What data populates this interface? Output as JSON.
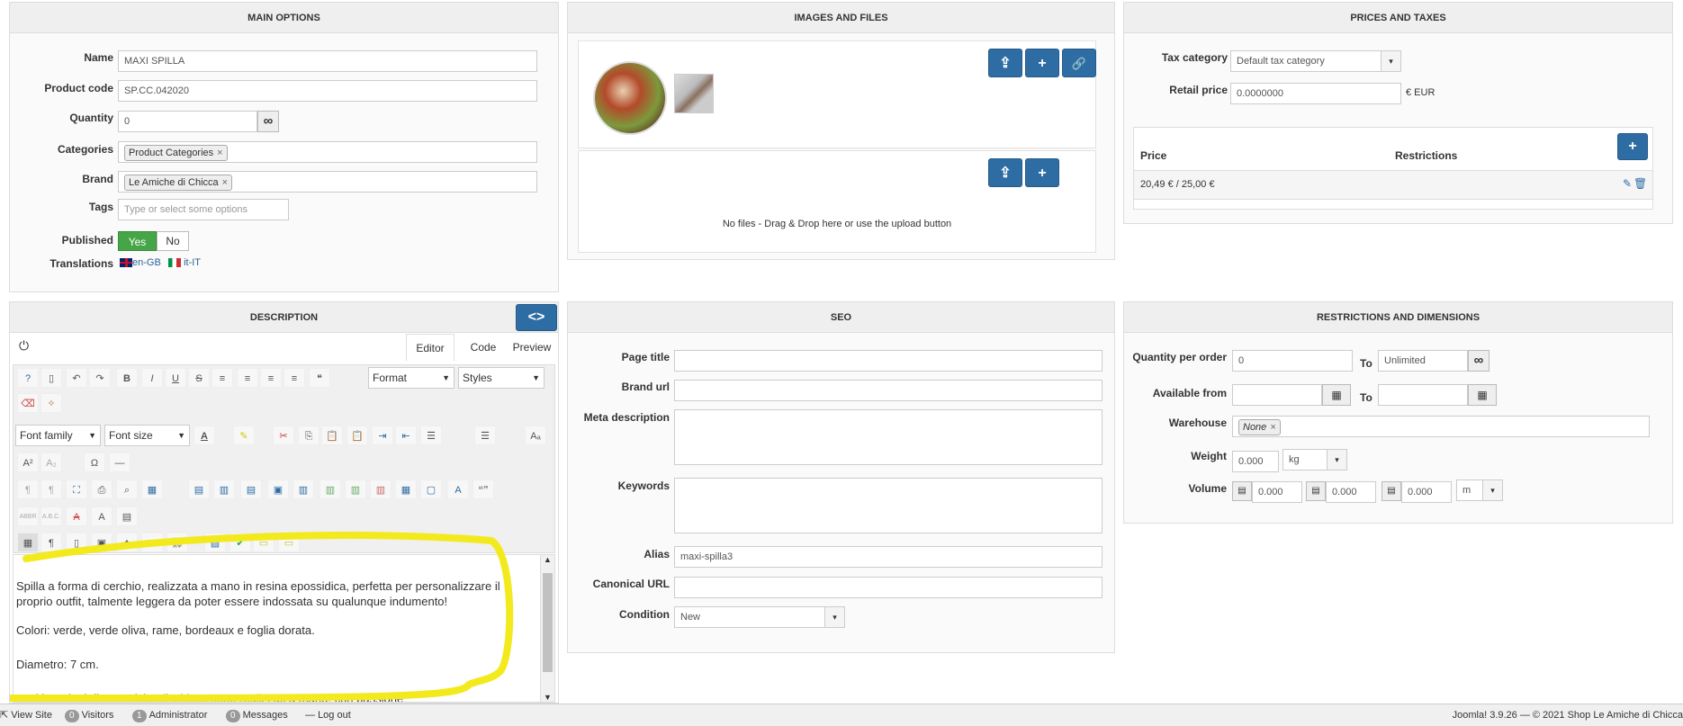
{
  "main_options": {
    "title": "MAIN OPTIONS",
    "name_label": "Name",
    "name_value": "MAXI SPILLA",
    "code_label": "Product code",
    "code_value": "SP.CC.042020",
    "qty_label": "Quantity",
    "qty_value": "0",
    "qty_icon": "∞",
    "categories_label": "Categories",
    "categories_chip": "Product Categories",
    "brand_label": "Brand",
    "brand_chip": "Le Amiche di Chicca",
    "tags_label": "Tags",
    "tags_placeholder": "Type or select some options",
    "published_label": "Published",
    "yes": "Yes",
    "no": "No",
    "translations_label": "Translations",
    "lang1": "en-GB",
    "lang2": "it-IT"
  },
  "images": {
    "title": "IMAGES AND FILES",
    "no_files": "No files - Drag & Drop here or use the upload button"
  },
  "prices": {
    "title": "PRICES AND TAXES",
    "tax_label": "Tax category",
    "tax_value": "Default tax category",
    "retail_label": "Retail price",
    "retail_value": "0.0000000",
    "currency": "€ EUR",
    "col_price": "Price",
    "col_restrictions": "Restrictions",
    "row_price": "20,49 € / 25,00 €"
  },
  "description": {
    "title": "DESCRIPTION",
    "tab_editor": "Editor",
    "tab_code": "Code",
    "tab_preview": "Preview",
    "format": "Format",
    "styles": "Styles",
    "font_family": "Font family",
    "font_size": "Font size",
    "p1": "Spilla a forma di cerchio, realizzata a mano in resina epossidica, perfetta per personalizzare il proprio outfit, talmente leggera da poter essere indossata su qualunque indumento!",
    "p2": "Colori: verde, verde oliva, rame, bordeaux e foglia dorata.",
    "p3": "Diametro: 7 cm.",
    "p4": "Tutti i prodotti di Le amiche di Chicca sono realizzati a mano, con passione"
  },
  "seo": {
    "title": "SEO",
    "page_title": "Page title",
    "brand_url": "Brand url",
    "meta_desc": "Meta description",
    "keywords": "Keywords",
    "alias": "Alias",
    "alias_value": "maxi-spilla3",
    "canonical": "Canonical URL",
    "condition": "Condition",
    "condition_value": "New"
  },
  "restrictions": {
    "title": "RESTRICTIONS AND DIMENSIONS",
    "qpo": "Quantity per order",
    "qpo_value": "0",
    "to": "To",
    "unlimited": "Unlimited",
    "available_from": "Available from",
    "warehouse": "Warehouse",
    "warehouse_chip": "None",
    "weight": "Weight",
    "weight_value": "0.000",
    "weight_unit": "kg",
    "volume": "Volume",
    "vol1": "0.000",
    "vol2": "0.000",
    "vol3": "0.000",
    "vol_unit": "m"
  },
  "status": {
    "view_site": "View Site",
    "visitors_count": "0",
    "visitors": "Visitors",
    "admin_count": "1",
    "admin": "Administrator",
    "messages_count": "0",
    "messages": "Messages",
    "logout": "Log out",
    "right": "Joomla! 3.9.26 — © 2021 Shop Le Amiche di Chicca"
  }
}
